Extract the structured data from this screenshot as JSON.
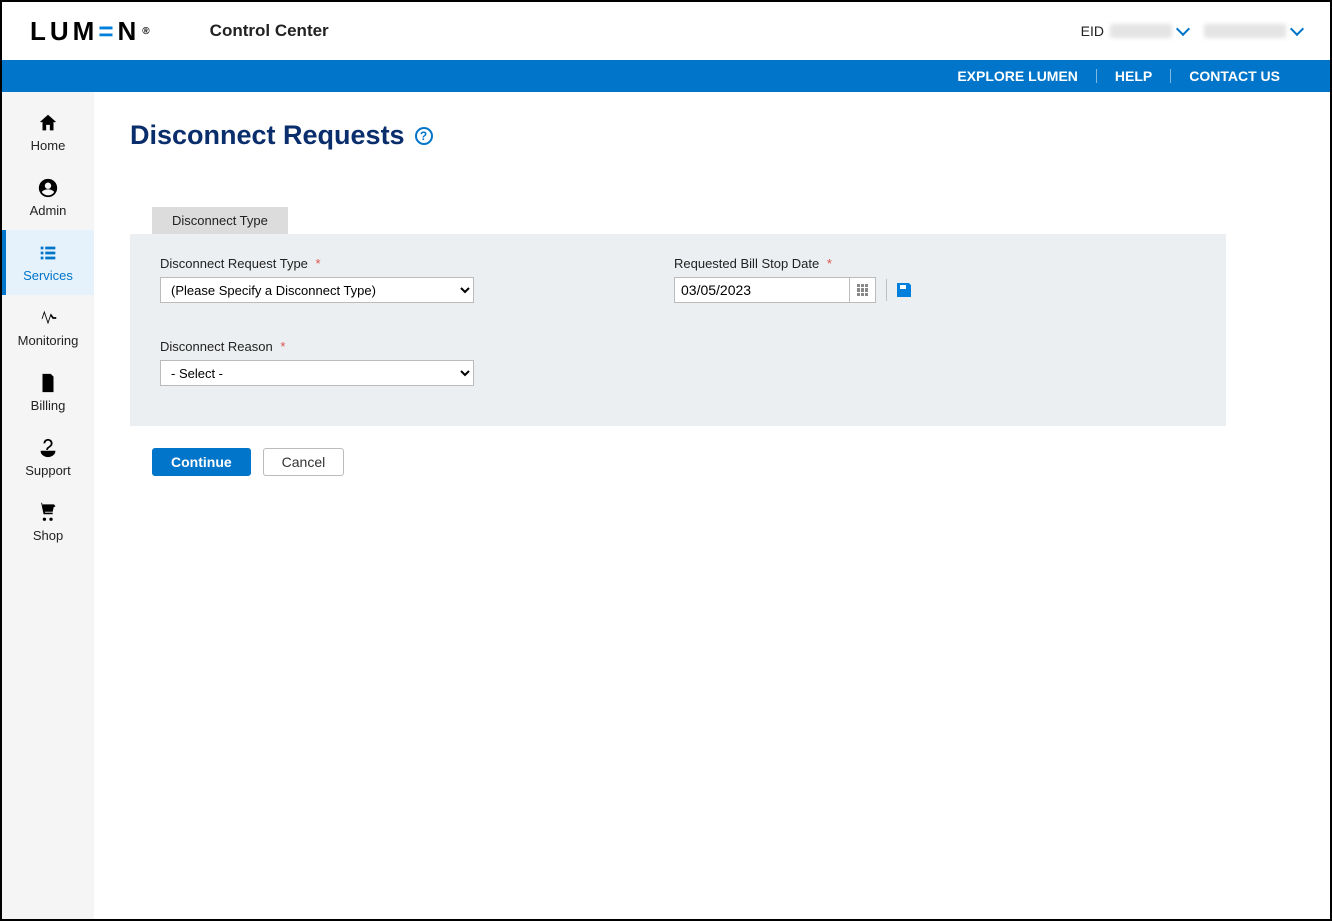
{
  "header": {
    "logo_prefix": "LUM",
    "logo_blue": "=",
    "logo_suffix": "N",
    "logo_reg": "®",
    "app_title": "Control Center",
    "eid_label": "EID"
  },
  "bluebar": {
    "explore": "EXPLORE LUMEN",
    "help": "HELP",
    "contact": "CONTACT US"
  },
  "sidebar": {
    "home": "Home",
    "admin": "Admin",
    "services": "Services",
    "monitoring": "Monitoring",
    "billing": "Billing",
    "support": "Support",
    "shop": "Shop"
  },
  "page": {
    "title": "Disconnect Requests",
    "help_icon": "?"
  },
  "tab": {
    "label": "Disconnect Type"
  },
  "form": {
    "request_type_label": "Disconnect Request Type",
    "request_type_value": "(Please Specify a Disconnect Type)",
    "bill_stop_label": "Requested Bill Stop Date",
    "bill_stop_value": "03/05/2023",
    "reason_label": "Disconnect Reason",
    "reason_value": "- Select -",
    "required_mark": "*"
  },
  "actions": {
    "continue": "Continue",
    "cancel": "Cancel"
  }
}
